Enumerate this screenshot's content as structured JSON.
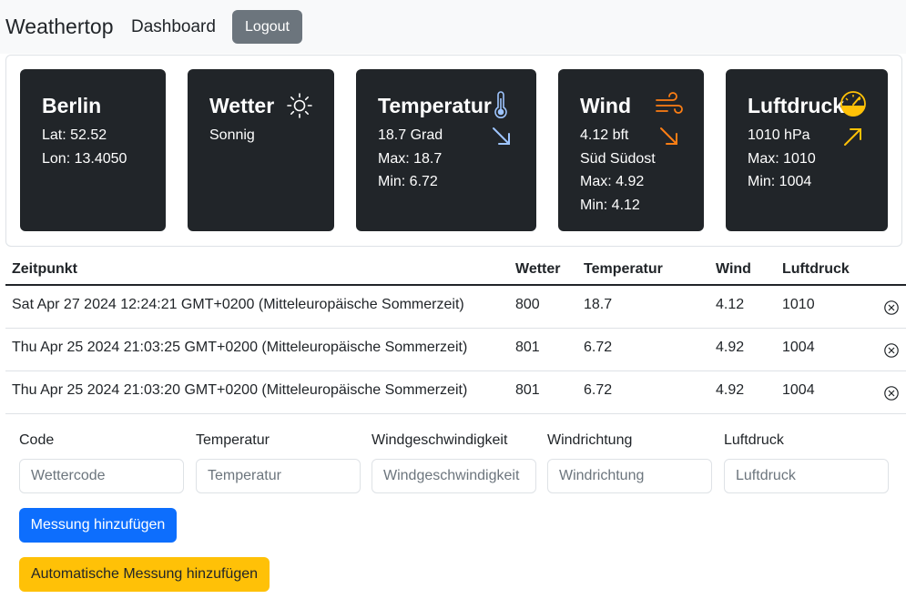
{
  "navbar": {
    "brand": "Weathertop",
    "dashboard_link": "Dashboard",
    "logout_label": "Logout"
  },
  "cards": {
    "station": {
      "title": "Berlin",
      "lat": "Lat: 52.52",
      "lon": "Lon: 13.4050"
    },
    "weather": {
      "title": "Wetter",
      "condition": "Sonnig",
      "icon": "sun-icon"
    },
    "temperature": {
      "title": "Temperatur",
      "value": "18.7 Grad",
      "max": "Max: 18.7",
      "min": "Min: 6.72",
      "icon": "thermometer-icon",
      "trend_icon": "arrow-down-right-icon",
      "trend_color": "#9ec5fe"
    },
    "wind": {
      "title": "Wind",
      "speed": "4.12 bft",
      "direction": "Süd Südost",
      "max": "Max: 4.92",
      "min": "Min: 4.12",
      "icon": "wind-icon",
      "trend_icon": "arrow-down-right-icon",
      "trend_color": "#fd7e14"
    },
    "pressure": {
      "title": "Luftdruck",
      "value": "1010 hPa",
      "max": "Max: 1010",
      "min": "Min: 1004",
      "icon": "speedometer-icon",
      "trend_icon": "arrow-up-right-icon",
      "trend_color": "#ffc107"
    }
  },
  "table": {
    "headers": [
      "Zeitpunkt",
      "Wetter",
      "Temperatur",
      "Wind",
      "Luftdruck"
    ],
    "rows": [
      {
        "time": "Sat Apr 27 2024 12:24:21 GMT+0200 (Mitteleuropäische Sommerzeit)",
        "code": "800",
        "temp": "18.7",
        "wind": "4.12",
        "pressure": "1010"
      },
      {
        "time": "Thu Apr 25 2024 21:03:25 GMT+0200 (Mitteleuropäische Sommerzeit)",
        "code": "801",
        "temp": "6.72",
        "wind": "4.92",
        "pressure": "1004"
      },
      {
        "time": "Thu Apr 25 2024 21:03:20 GMT+0200 (Mitteleuropäische Sommerzeit)",
        "code": "801",
        "temp": "6.72",
        "wind": "4.92",
        "pressure": "1004"
      }
    ]
  },
  "form": {
    "fields": [
      {
        "label": "Code",
        "placeholder": "Wettercode"
      },
      {
        "label": "Temperatur",
        "placeholder": "Temperatur"
      },
      {
        "label": "Windgeschwindigkeit",
        "placeholder": "Windgeschwindigkeit"
      },
      {
        "label": "Windrichtung",
        "placeholder": "Windrichtung"
      },
      {
        "label": "Luftdruck",
        "placeholder": "Luftdruck"
      }
    ],
    "add_button": "Messung hinzufügen",
    "auto_button": "Automatische Messung hinzufügen"
  },
  "colors": {
    "card_bg": "#212529",
    "primary": "#0d6efd",
    "warning": "#ffc107",
    "secondary": "#6c757d"
  }
}
